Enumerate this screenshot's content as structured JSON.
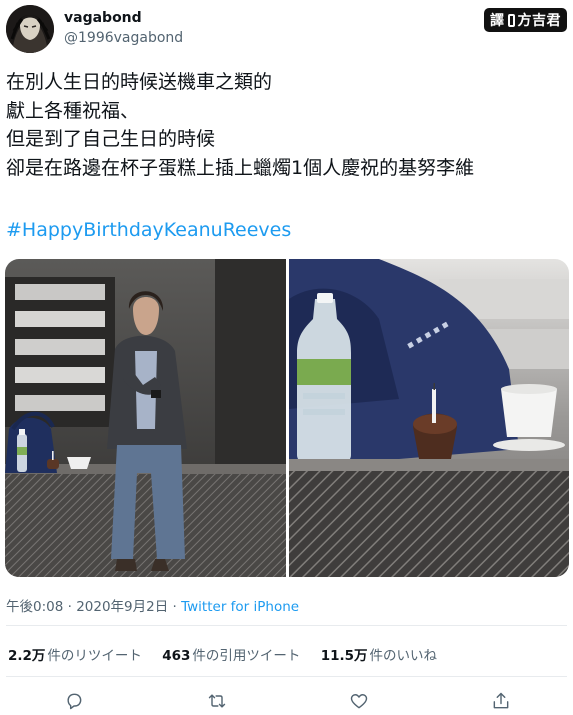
{
  "author": {
    "display_name": "vagabond",
    "handle": "@1996vagabond",
    "avatar_icon": "avatar-portrait"
  },
  "watermark": {
    "left": "譯",
    "right": "方吉君"
  },
  "tweet": {
    "lines": [
      "在別人生日的時候送機車之類的",
      "獻上各種祝福、",
      "但是到了自己生日的時候",
      "卻是在路邊在杯子蛋糕上插上蠟燭1個人慶祝的基努李維"
    ],
    "hashtag": "#HappyBirthdayKeanuReeves"
  },
  "meta": {
    "time": "午後0:08",
    "separator": " · ",
    "date": "2020年9月2日",
    "source": "Twitter for iPhone"
  },
  "stats": {
    "retweets_count": "2.2万",
    "retweets_label": "件のリツイート",
    "quotes_count": "463",
    "quotes_label": "件の引用ツイート",
    "likes_count": "11.5万",
    "likes_label": "件のいいね"
  },
  "actions": [
    "reply-icon",
    "retweet-icon",
    "like-icon",
    "share-icon"
  ],
  "colors": {
    "link": "#1d9bf0",
    "text": "#0f1419",
    "muted": "#536471"
  }
}
